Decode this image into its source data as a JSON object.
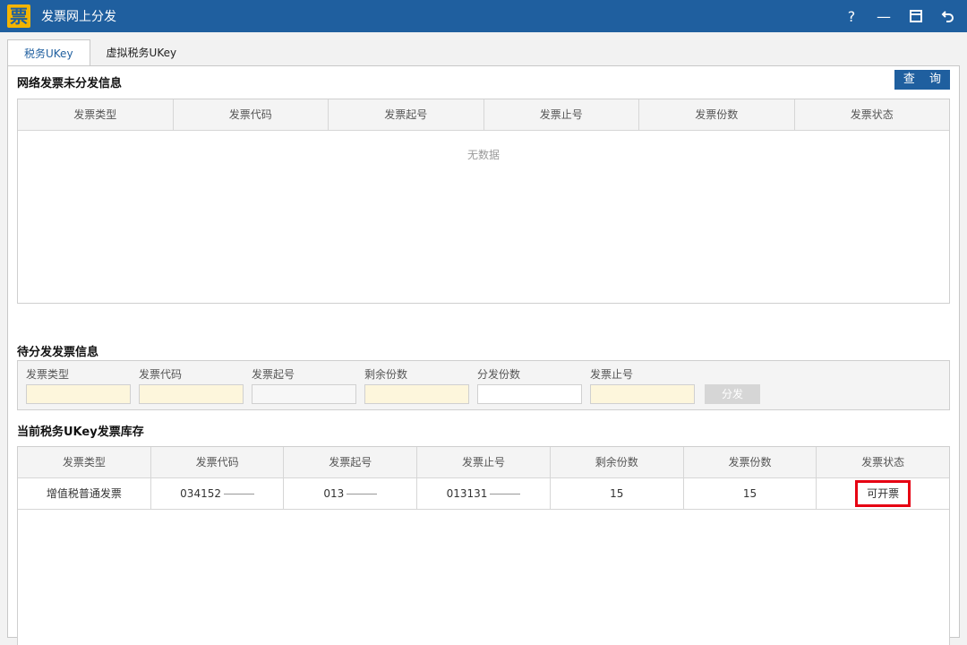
{
  "window": {
    "logo_char": "票",
    "title": "发票网上分发",
    "controls": [
      "?",
      "—",
      "restore",
      "back"
    ]
  },
  "tabs": [
    {
      "label": "税务UKey",
      "active": true
    },
    {
      "label": "虚拟税务UKey",
      "active": false
    }
  ],
  "section1": {
    "title": "网络发票未分发信息",
    "query_label": "查 询",
    "columns": [
      "发票类型",
      "发票代码",
      "发票起号",
      "发票止号",
      "发票份数",
      "发票状态"
    ],
    "empty_text": "无数据"
  },
  "section2": {
    "title": "待分发发票信息",
    "fields": [
      {
        "label": "发票类型",
        "value": ""
      },
      {
        "label": "发票代码",
        "value": ""
      },
      {
        "label": "发票起号",
        "value": ""
      },
      {
        "label": "剩余份数",
        "value": ""
      },
      {
        "label": "分发份数",
        "value": ""
      },
      {
        "label": "发票止号",
        "value": ""
      }
    ],
    "distribute_label": "分发"
  },
  "section3": {
    "title": "当前税务UKey发票库存",
    "columns": [
      "发票类型",
      "发票代码",
      "发票起号",
      "发票止号",
      "剩余份数",
      "发票份数",
      "发票状态"
    ],
    "rows": [
      [
        "增值税普通发票",
        "034152",
        "013",
        "013131",
        "15",
        "15",
        "可开票"
      ]
    ]
  },
  "colors": {
    "titlebar": "#1f5f9f",
    "highlight": "#e60012"
  }
}
